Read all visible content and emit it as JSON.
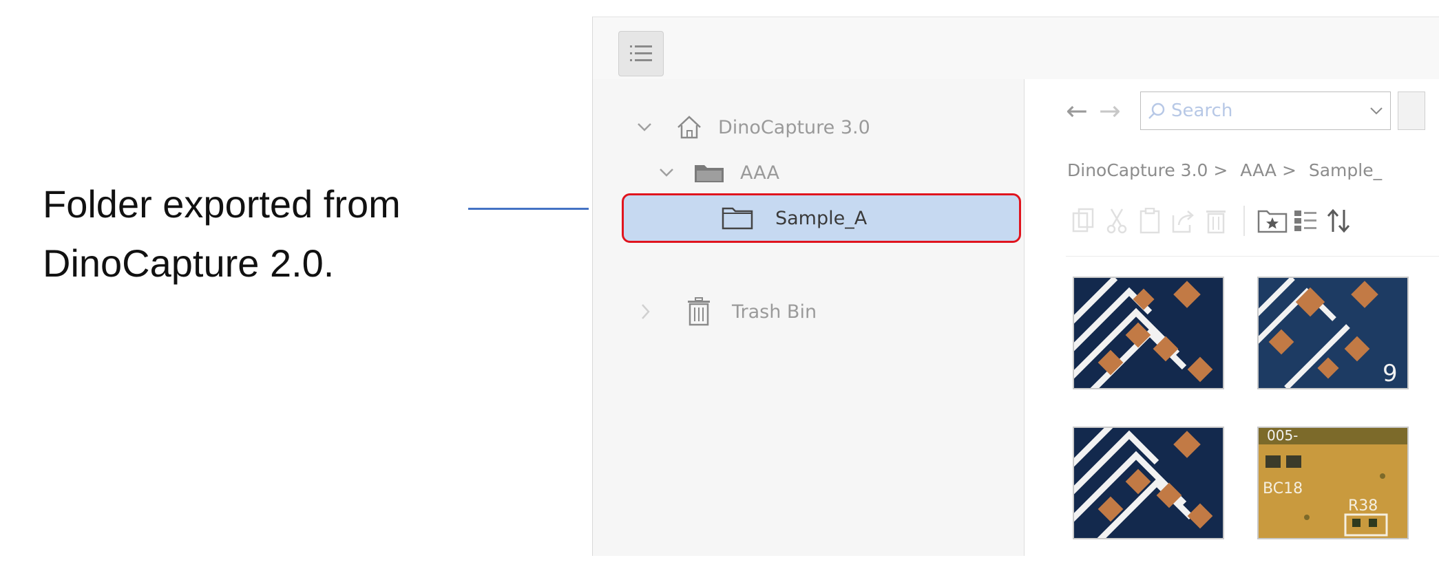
{
  "annotation": {
    "lines": [
      "Folder exported from",
      "DinoCapture 2.0."
    ],
    "line_color": "#4472c4"
  },
  "toolbar_top": {
    "menu_icon": "list-menu-icon"
  },
  "tree": {
    "root": {
      "label": "DinoCapture 3.0",
      "icon": "home-icon"
    },
    "folder": {
      "label": "AAA",
      "icon": "folder-filled-icon"
    },
    "selected": {
      "label": "Sample_A",
      "icon": "folder-outline-icon",
      "highlight_color": "#e0141e"
    },
    "trash": {
      "label": "Trash Bin",
      "icon": "trash-icon"
    }
  },
  "content": {
    "search_placeholder": "Search",
    "breadcrumb": [
      "DinoCapture 3.0 >",
      "AAA >",
      "Sample_"
    ],
    "toolbar_icons": [
      "copy-icon",
      "cut-icon",
      "paste-icon",
      "share-icon",
      "delete-icon",
      "new-folder-star-icon",
      "list-view-icon",
      "sort-icon"
    ],
    "thumbnails": [
      "pcb-image-1",
      "pcb-image-2",
      "pcb-image-3",
      "pcb-image-4"
    ],
    "thumb_labels": {
      "t2": "9",
      "t4_a": "BC18",
      "t4_b": "R38",
      "t4_c": "005-"
    }
  }
}
